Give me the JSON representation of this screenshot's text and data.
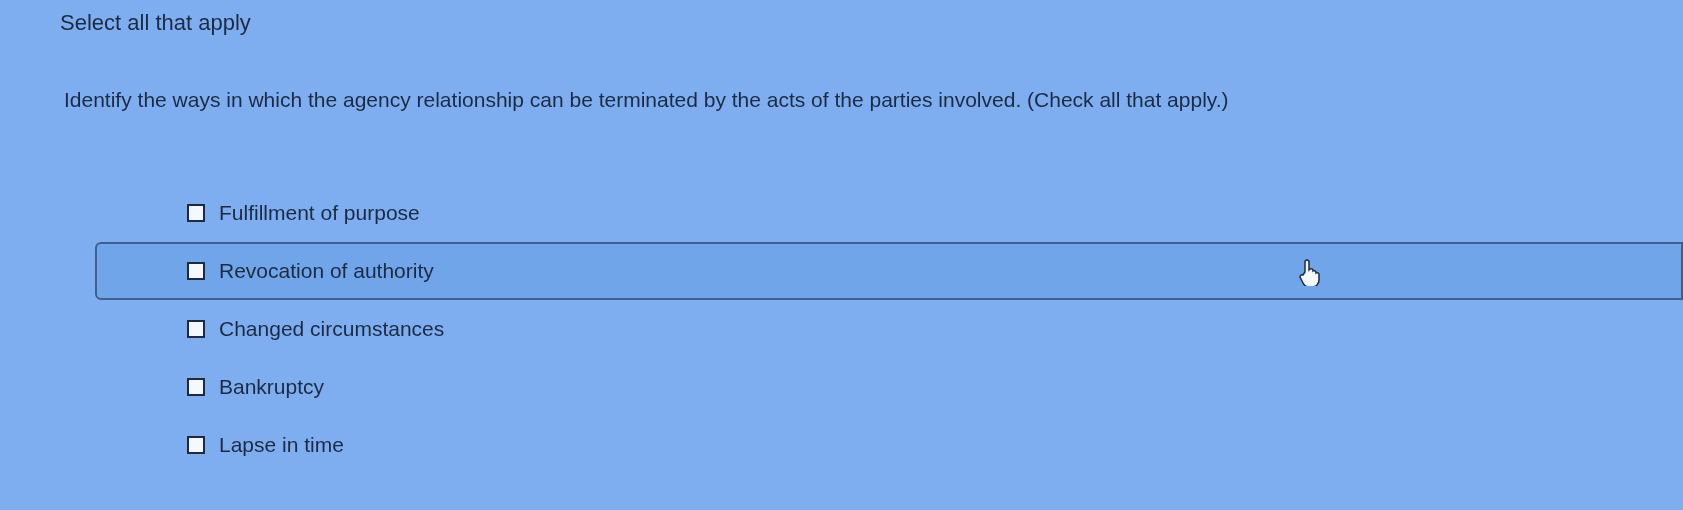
{
  "heading": "Select all that apply",
  "question": "Identify the ways in which the agency relationship can be terminated by the acts of the parties involved. (Check all that apply.)",
  "options": [
    {
      "label": "Fulfillment of purpose",
      "checked": false,
      "hovered": false
    },
    {
      "label": "Revocation of authority",
      "checked": false,
      "hovered": true
    },
    {
      "label": "Changed circumstances",
      "checked": false,
      "hovered": false
    },
    {
      "label": "Bankruptcy",
      "checked": false,
      "hovered": false
    },
    {
      "label": "Lapse in time",
      "checked": false,
      "hovered": false
    }
  ]
}
